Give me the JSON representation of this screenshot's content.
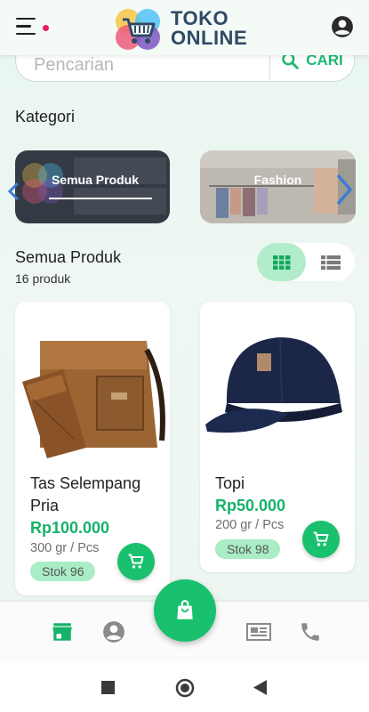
{
  "header": {
    "logo_line1": "TOKO",
    "logo_line2": "ONLINE",
    "colors": {
      "logo_text": "#2e4a66",
      "notification_dot": "#e91e63"
    }
  },
  "search": {
    "placeholder": "Pencarian",
    "button_label": "CARI",
    "button_icon": "search-icon"
  },
  "categories": {
    "title": "Kategori",
    "items": [
      {
        "label": "Semua Produk",
        "selected": true
      },
      {
        "label": "Fashion",
        "selected": false
      }
    ]
  },
  "products": {
    "title": "Semua Produk",
    "count": "16 produk",
    "view_mode": "grid",
    "items": [
      {
        "name": "Tas Selempang Pria",
        "price": "Rp100.000",
        "weight": "300 gr / Pcs",
        "stock": "Stok 96"
      },
      {
        "name": "Topi",
        "price": "Rp50.000",
        "weight": "200 gr / Pcs",
        "stock": "Stok 98"
      }
    ]
  },
  "bottom_nav": {
    "items": [
      "store-icon",
      "account-icon",
      "shopping-bag-icon",
      "newspaper-icon",
      "phone-icon"
    ],
    "active": "store-icon"
  },
  "theme": {
    "accent": "#19c06d",
    "price": "#16b26a",
    "stock_badge": "#a9ecc5"
  }
}
